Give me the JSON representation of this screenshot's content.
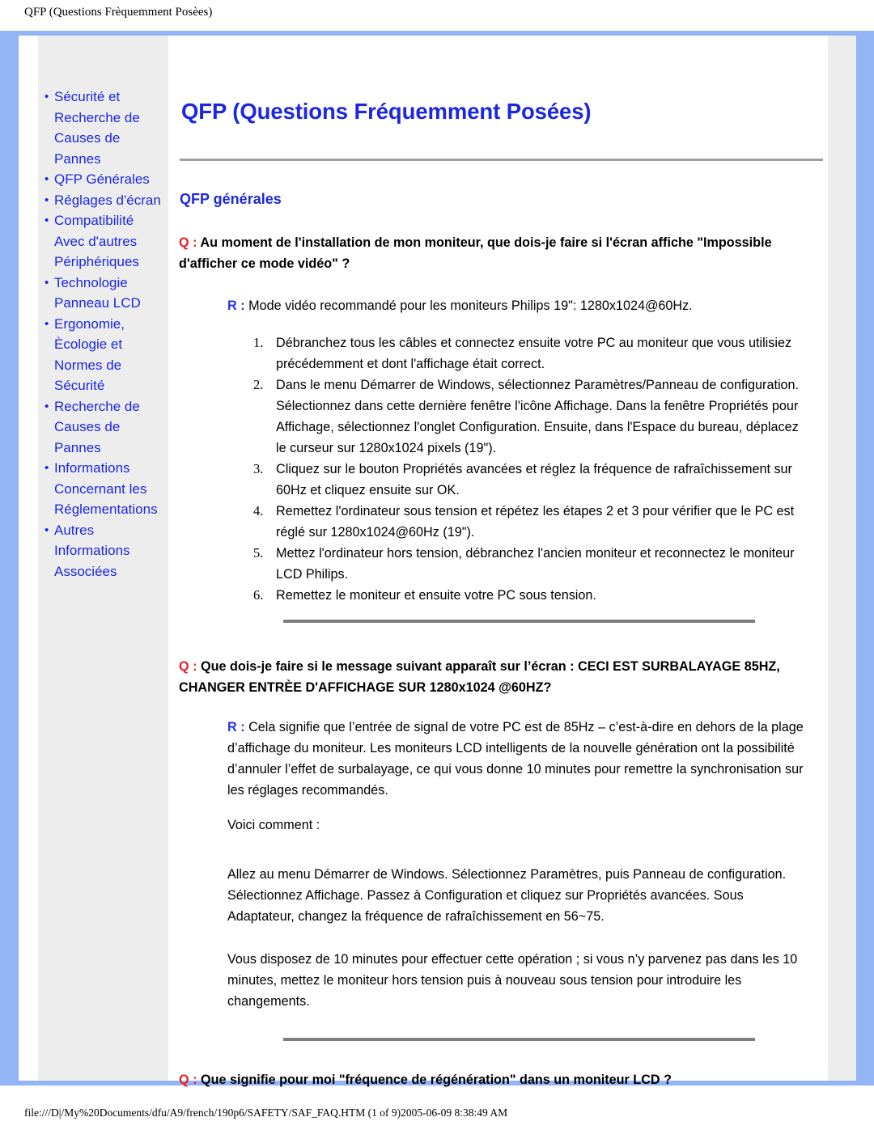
{
  "browser": {
    "print_header": "QFP (Questions Frèquemment Posèes)",
    "print_footer": "file:///D|/My%20Documents/dfu/A9/french/190p6/SAFETY/SAF_FAQ.HTM (1 of 9)2005-06-09 8:38:49 AM"
  },
  "colors": {
    "frame_blue": "#93b4f5",
    "link_blue": "#1c27e0",
    "q_red": "#ec1c24",
    "a_blue": "#2633e8",
    "sidebar_grey": "#ededed",
    "rule_grey": "#a0a0a0"
  },
  "sidebar": {
    "items": [
      {
        "label": "Sécurité et Recherche de Causes de Pannes"
      },
      {
        "label": "QFP Générales"
      },
      {
        "label": "Réglages d'écran"
      },
      {
        "label": "Compatibilité Avec d'autres Périphériques"
      },
      {
        "label": "Technologie Panneau LCD"
      },
      {
        "label": "Ergonomie, Ècologie et Normes de Sécurité"
      },
      {
        "label": "Recherche de Causes de Pannes"
      },
      {
        "label": "Informations Concernant les Réglementations"
      },
      {
        "label": "Autres Informations Associées"
      }
    ]
  },
  "main": {
    "title": "QFP (Questions Fréquemment Posées)",
    "section_title": "QFP générales",
    "q_marker": "Q",
    "a_marker": "R",
    "colon": " : ",
    "qa": [
      {
        "question": "Au moment de l'installation de mon moniteur, que dois-je faire si l'écran affiche \"Impossible d'afficher ce mode vidéo\" ?",
        "answer": "Mode vidéo recommandé pour les moniteurs Philips 19\": 1280x1024@60Hz.",
        "steps": [
          "Débranchez tous les câbles et connectez ensuite votre PC au moniteur que vous utilisiez précédemment et dont l'affichage était correct.",
          "Dans le menu Démarrer de Windows, sélectionnez Paramètres/Panneau de configuration. Sélectionnez dans cette dernière fenêtre l'icône Affichage. Dans la fenêtre Propriétés pour Affichage, sélectionnez l'onglet Configuration. Ensuite, dans l'Espace du bureau, déplacez le curseur sur 1280x1024 pixels (19\").",
          "Cliquez sur le bouton Propriétés avancées et réglez la fréquence de rafraîchissement sur 60Hz et cliquez ensuite sur OK.",
          "Remettez l'ordinateur sous tension et répétez les étapes 2 et 3 pour vérifier que le PC est réglé sur 1280x1024@60Hz (19\").",
          "Mettez l'ordinateur hors tension, débranchez l'ancien moniteur et reconnectez le moniteur LCD Philips.",
          "Remettez le moniteur et ensuite votre PC sous tension."
        ]
      },
      {
        "question": "Que dois-je faire si le message suivant apparaît sur l’écran : CECI EST SURBALAYAGE 85HZ, CHANGER ENTRÈE D'AFFICHAGE SUR 1280x1024 @60HZ?",
        "answer": "Cela signifie que l’entrée de signal de votre PC est de 85Hz – c’est-à-dire en dehors de la plage d’affichage du moniteur. Les moniteurs LCD intelligents de la nouvelle génération ont la possibilité d’annuler l’effet de surbalayage, ce qui vous donne 10 minutes pour remettre la synchronisation sur les réglages recommandés.",
        "extra_paragraphs": [
          "Voici comment :",
          "Allez au menu Démarrer de Windows. Sélectionnez Paramètres, puis Panneau de configuration. Sélectionnez Affichage. Passez à Configuration et cliquez sur Propriétés avancées. Sous Adaptateur, changez la fréquence de rafraîchissement en 56~75.",
          "Vous disposez de 10 minutes pour effectuer cette opération ; si vous n’y parvenez pas dans les 10 minutes, mettez le moniteur hors tension puis à nouveau sous tension pour introduire les changements."
        ]
      },
      {
        "question": "Que signifie pour moi \"fréquence de régénération\" dans un moniteur LCD ?"
      }
    ]
  }
}
